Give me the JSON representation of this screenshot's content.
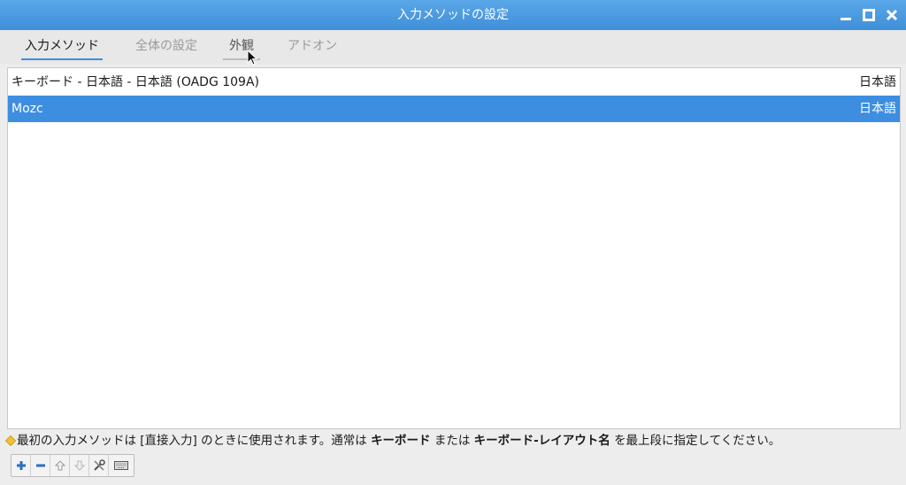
{
  "window": {
    "title": "入力メソッドの設定"
  },
  "tabs": [
    {
      "label": "入力メソッド",
      "state": "active"
    },
    {
      "label": "全体の設定",
      "state": "inactive"
    },
    {
      "label": "外観",
      "state": "hovered"
    },
    {
      "label": "アドオン",
      "state": "inactive"
    }
  ],
  "input_methods": [
    {
      "name": "キーボード - 日本語 - 日本語 (OADG 109A)",
      "language": "日本語",
      "selected": false
    },
    {
      "name": "Mozc",
      "language": "日本語",
      "selected": true
    }
  ],
  "hint": {
    "icon": "hint-diamond-icon",
    "part1": "最初の入力メソッドは [直接入力] のときに使用されます。通常は",
    "bold1": "キーボード",
    "part2": "または",
    "bold2": "キーボード-レイアウト名",
    "part3": "を最上段に指定してください。"
  },
  "toolbar": {
    "buttons": [
      "add-icon",
      "remove-icon",
      "move-up-icon",
      "move-down-icon",
      "configure-icon",
      "keyboard-layout-icon"
    ]
  },
  "colors": {
    "titlebar": "#3f8fd9",
    "selection": "#3d8ee0",
    "add_icon": "#2a6fc4"
  }
}
